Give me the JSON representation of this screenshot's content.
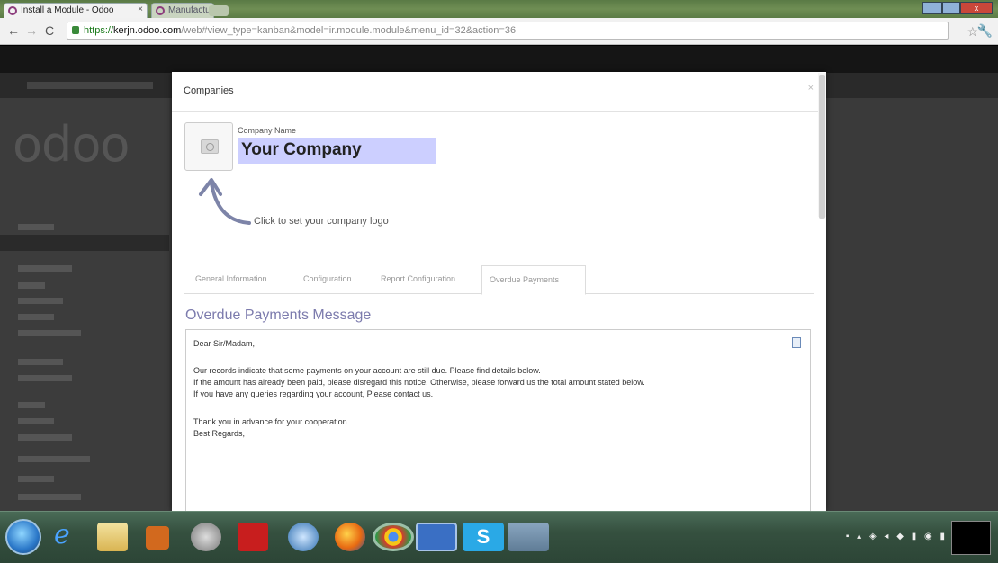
{
  "browser": {
    "tabs": [
      {
        "label": "Install a Module - Odoo",
        "active": true
      },
      {
        "label": "Manufacturing Orders - Odoo",
        "active": false
      }
    ],
    "url_scheme": "https://",
    "url_host": "kerjn.odoo.com",
    "url_path": "/web#view_type=kanban&model=ir.module.module&menu_id=32&action=36",
    "back_icon": "arrow-left-icon",
    "forward_icon": "arrow-right-icon",
    "reload_icon": "reload-icon",
    "star_icon": "star-icon",
    "menu_icon": "wrench-icon"
  },
  "background": {
    "logo_text": "odoo"
  },
  "modal": {
    "title": "Companies",
    "close_label": "×",
    "company_name_label": "Company Name",
    "company_name_value": "Your Company",
    "logo_hint": "Click to set your company logo",
    "tabs": [
      {
        "label": "General Information",
        "active": false
      },
      {
        "label": "Configuration",
        "active": false
      },
      {
        "label": "Report Configuration",
        "active": false
      },
      {
        "label": "Overdue Payments",
        "active": true
      }
    ],
    "section_title": "Overdue Payments Message",
    "message_lines": [
      "Dear Sir/Madam,",
      "",
      "Our records indicate that some payments on your account are still due. Please find details below.",
      "If the amount has already been paid, please disregard this notice. Otherwise, please forward us the total amount stated below.",
      "If you have any queries regarding your account, Please contact us.",
      "",
      "Thank you in advance for your cooperation.",
      "Best Regards,"
    ]
  },
  "taskbar": {
    "icons": [
      "start-orb-icon",
      "internet-explorer-icon",
      "file-explorer-icon",
      "media-player-icon",
      "clock-app-icon",
      "acrobat-icon",
      "network-icon",
      "firefox-icon",
      "chrome-icon",
      "word-icon",
      "skype-icon",
      "paint-icon"
    ]
  },
  "colors": {
    "accent_purple": "#7c7bad",
    "field_highlight": "#cccfff"
  }
}
